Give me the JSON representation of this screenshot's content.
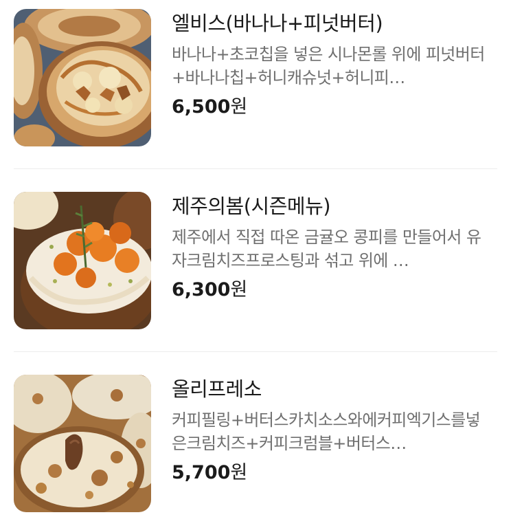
{
  "menu": {
    "items": [
      {
        "name": "엘비스(바나나+피넛버터)",
        "description": "바나나+초코칩을 넣은 시나몬롤 위에 피넛버터+바나나칩+허니캐슈넛+허니피…",
        "price_amount": "6,500",
        "price_unit": "원",
        "image": "banana-peanut-cinnamon-roll-photo"
      },
      {
        "name": "제주의봄(시즌메뉴)",
        "description": "제주에서 직접 따온 금귤오 콩피를 만들어서 유자크림치즈프로스팅과 섞고 위에 …",
        "price_amount": "6,300",
        "price_unit": "원",
        "image": "kumquat-cream-cheese-roll-photo"
      },
      {
        "name": "올리프레소",
        "description": "커피필링+버터스카치소스와에커피엑기스를넣은크림치즈+커피크럼블+버터스…",
        "price_amount": "5,700",
        "price_unit": "원",
        "image": "coffee-crumble-roll-photo"
      }
    ]
  }
}
